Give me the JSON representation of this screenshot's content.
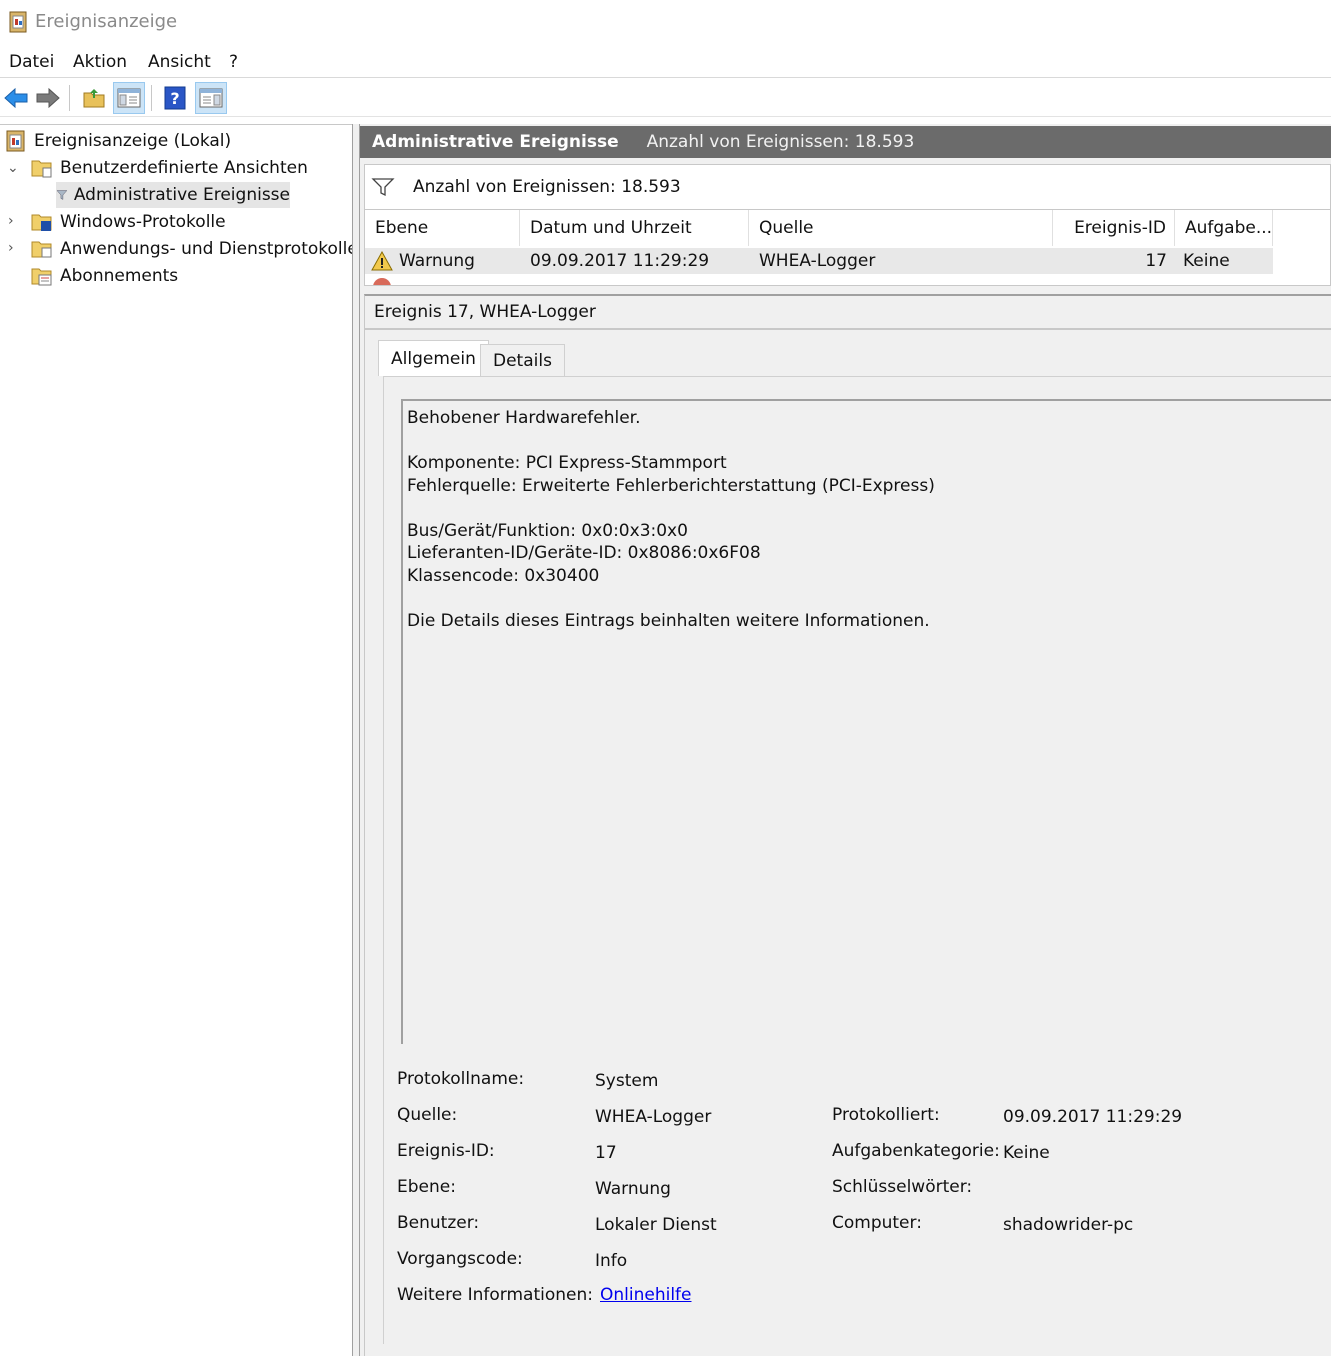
{
  "window": {
    "title": "Ereignisanzeige"
  },
  "menu": [
    "Datei",
    "Aktion",
    "Ansicht",
    "?"
  ],
  "toolbar": [
    "back-icon",
    "forward-icon",
    "open-folder-icon",
    "show-hide-tree-icon",
    "help-icon",
    "show-hide-action-pane-icon"
  ],
  "tree": {
    "root": "Ereignisanzeige (Lokal)",
    "custom_views": "Benutzerdefinierte Ansichten",
    "admin_events": "Administrative Ereignisse",
    "windows_logs": "Windows-Protokolle",
    "app_logs": "Anwendungs- und Dienstprotokolle",
    "subscriptions": "Abonnements"
  },
  "header": {
    "title": "Administrative Ereignisse",
    "count": "Anzahl von Ereignissen: 18.593"
  },
  "filter": {
    "text": "Anzahl von Ereignissen: 18.593"
  },
  "grid": {
    "columns": [
      "Ebene",
      "Datum und Uhrzeit",
      "Quelle",
      "Ereignis-ID",
      "Aufgabe..."
    ],
    "rows": [
      {
        "level": "Warnung",
        "date": "09.09.2017 11:29:29",
        "source": "WHEA-Logger",
        "id": "17",
        "task": "Keine"
      }
    ]
  },
  "detail": {
    "title": "Ereignis 17, WHEA-Logger",
    "tabs": [
      "Allgemein",
      "Details"
    ],
    "message": [
      "Behobener Hardwarefehler.",
      "",
      "Komponente: PCI Express-Stammport",
      "Fehlerquelle: Erweiterte Fehlerberichterstattung (PCI-Express)",
      "",
      "Bus/Gerät/Funktion: 0x0:0x3:0x0",
      "Lieferanten-ID/Geräte-ID: 0x8086:0x6F08",
      "Klassencode: 0x30400",
      "",
      "Die Details dieses Eintrags beinhalten weitere Informationen."
    ],
    "props": {
      "log_name_label": "Protokollname:",
      "log_name": "System",
      "source_label": "Quelle:",
      "source": "WHEA-Logger",
      "logged_label": "Protokolliert:",
      "logged": "09.09.2017 11:29:29",
      "event_id_label": "Ereignis-ID:",
      "event_id": "17",
      "task_cat_label": "Aufgabenkategorie:",
      "task_cat": "Keine",
      "level_label": "Ebene:",
      "level": "Warnung",
      "keywords_label": "Schlüsselwörter:",
      "keywords": "",
      "user_label": "Benutzer:",
      "user": "Lokaler Dienst",
      "computer_label": "Computer:",
      "computer": "shadowrider-pc",
      "opcode_label": "Vorgangscode:",
      "opcode": "Info",
      "more_info_label": "Weitere Informationen:",
      "more_info": "Onlinehilfe"
    }
  },
  "colors": {
    "header_bg": "#6b6b6b",
    "selection": "#e5e5e5",
    "link": "#0000ee",
    "toolbar_pressed": "#cce4f7"
  }
}
